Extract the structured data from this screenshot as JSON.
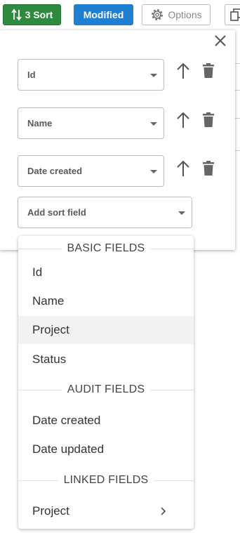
{
  "toolbar": {
    "sort_label": "3 Sort",
    "modified_label": "Modified",
    "options_label": "Options"
  },
  "sort_panel": {
    "rows": [
      {
        "field": "Id"
      },
      {
        "field": "Name"
      },
      {
        "field": "Date created"
      }
    ],
    "add_placeholder": "Add sort field"
  },
  "dropdown": {
    "basic_header": "BASIC FIELDS",
    "basic_items": [
      "Id",
      "Name",
      "Project",
      "Status"
    ],
    "audit_header": "AUDIT FIELDS",
    "audit_items": [
      "Date created",
      "Date updated"
    ],
    "linked_header": "LINKED FIELDS",
    "linked_items": [
      "Project"
    ],
    "highlighted_item": "Project"
  },
  "colors": {
    "sort_button": "#2e8a3e",
    "modified_button": "#1f7fd1",
    "highlight_row": "#f2f2f2"
  }
}
